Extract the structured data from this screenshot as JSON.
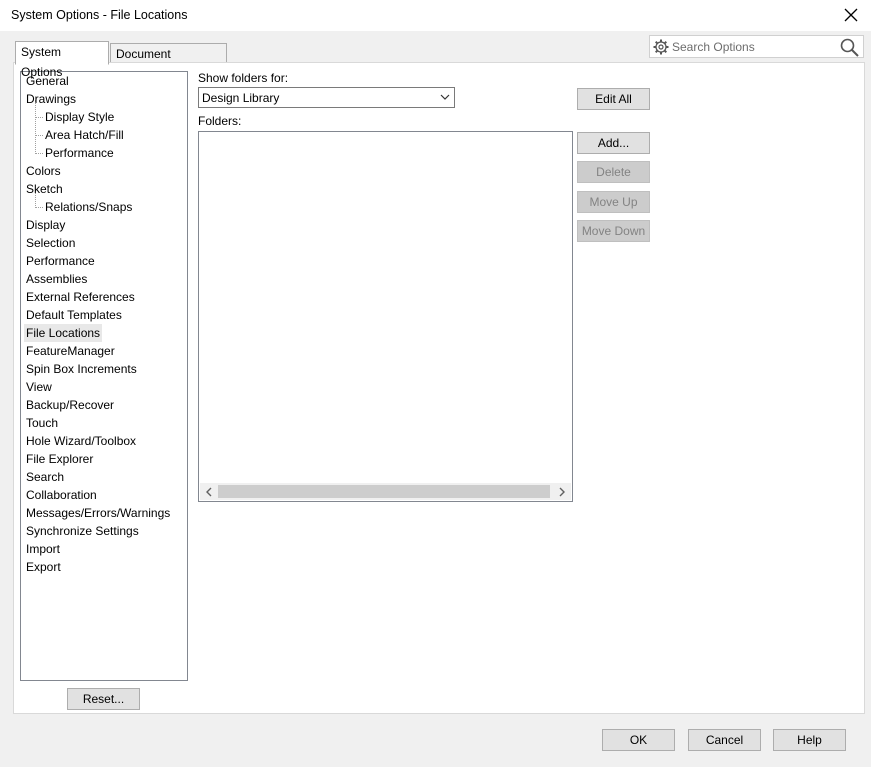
{
  "window": {
    "title": "System Options - File Locations"
  },
  "tabs": [
    {
      "label": "System Options",
      "active": true
    },
    {
      "label": "Document Properties",
      "active": false
    }
  ],
  "search": {
    "placeholder": "Search Options",
    "icon": "search-icon",
    "options_icon": "gear-icon"
  },
  "tree": {
    "selected": "File Locations",
    "items": [
      {
        "label": "General",
        "level": 0
      },
      {
        "label": "Drawings",
        "level": 0
      },
      {
        "label": "Display Style",
        "level": 1
      },
      {
        "label": "Area Hatch/Fill",
        "level": 1
      },
      {
        "label": "Performance",
        "level": 1
      },
      {
        "label": "Colors",
        "level": 0
      },
      {
        "label": "Sketch",
        "level": 0
      },
      {
        "label": "Relations/Snaps",
        "level": 1
      },
      {
        "label": "Display",
        "level": 0
      },
      {
        "label": "Selection",
        "level": 0
      },
      {
        "label": "Performance",
        "level": 0
      },
      {
        "label": "Assemblies",
        "level": 0
      },
      {
        "label": "External References",
        "level": 0
      },
      {
        "label": "Default Templates",
        "level": 0
      },
      {
        "label": "File Locations",
        "level": 0
      },
      {
        "label": "FeatureManager",
        "level": 0
      },
      {
        "label": "Spin Box Increments",
        "level": 0
      },
      {
        "label": "View",
        "level": 0
      },
      {
        "label": "Backup/Recover",
        "level": 0
      },
      {
        "label": "Touch",
        "level": 0
      },
      {
        "label": "Hole Wizard/Toolbox",
        "level": 0
      },
      {
        "label": "File Explorer",
        "level": 0
      },
      {
        "label": "Search",
        "level": 0
      },
      {
        "label": "Collaboration",
        "level": 0
      },
      {
        "label": "Messages/Errors/Warnings",
        "level": 0
      },
      {
        "label": "Synchronize Settings",
        "level": 0
      },
      {
        "label": "Import",
        "level": 0
      },
      {
        "label": "Export",
        "level": 0
      }
    ]
  },
  "main": {
    "show_folders_label": "Show folders for:",
    "show_folders_value": "Design Library",
    "folders_label": "Folders:",
    "edit_all": "Edit All",
    "add": "Add...",
    "delete": "Delete",
    "move_up": "Move Up",
    "move_down": "Move Down"
  },
  "buttons": {
    "reset": "Reset...",
    "ok": "OK",
    "cancel": "Cancel",
    "help": "Help"
  }
}
